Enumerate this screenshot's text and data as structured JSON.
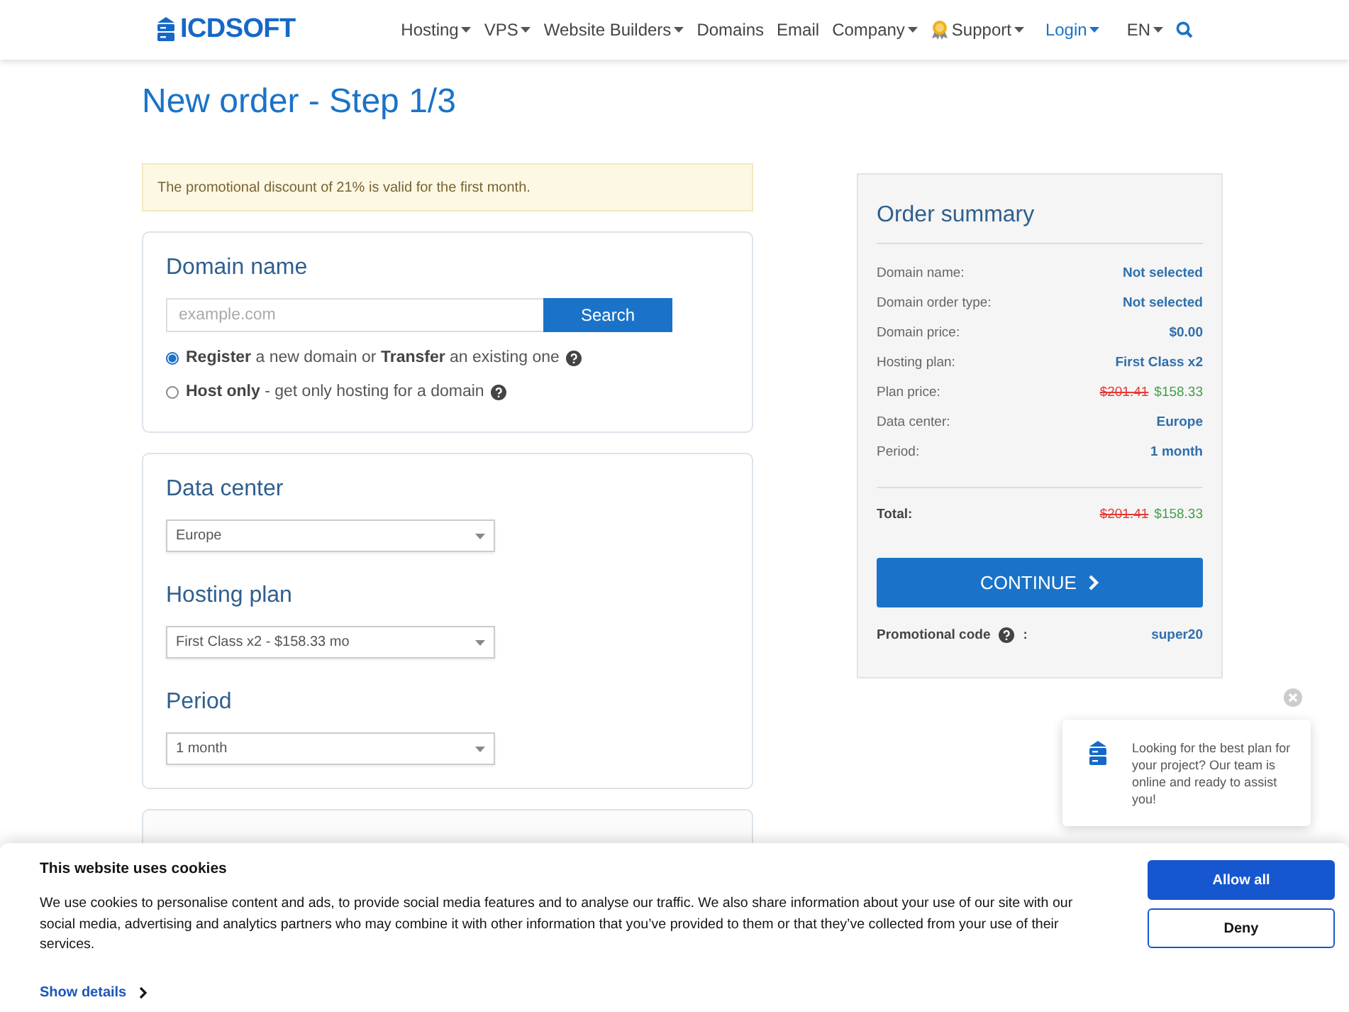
{
  "header": {
    "logo": "ICDSOFT",
    "nav": [
      {
        "label": "Hosting",
        "kind": "link",
        "dropdown": true,
        "highlighted": false
      },
      {
        "label": "VPS",
        "kind": "link",
        "dropdown": true,
        "highlighted": false
      },
      {
        "label": "Website Builders",
        "kind": "link",
        "dropdown": true,
        "highlighted": false
      },
      {
        "label": "Domains",
        "kind": "link",
        "dropdown": false,
        "highlighted": false
      },
      {
        "label": "Email",
        "kind": "link",
        "dropdown": false,
        "highlighted": false
      },
      {
        "label": "Company",
        "kind": "link",
        "dropdown": true,
        "highlighted": false
      },
      {
        "label": "Support",
        "kind": "support",
        "dropdown": true,
        "highlighted": false
      },
      {
        "label": "Login",
        "kind": "link",
        "dropdown": true,
        "highlighted": true
      },
      {
        "label": "EN",
        "kind": "link",
        "dropdown": true,
        "highlighted": false
      }
    ]
  },
  "page_title": "New order - Step 1/3",
  "notice": "The promotional discount of 21% is valid for the first month.",
  "domain": {
    "heading": "Domain name",
    "placeholder": "example.com",
    "button": "Search",
    "options": [
      {
        "label": "**Register** a new domain or **Transfer** an existing one",
        "selected": true
      },
      {
        "label": "**Host only** - get only hosting for a domain",
        "selected": false
      }
    ]
  },
  "selects": [
    {
      "heading": "Data center",
      "value": "Europe"
    },
    {
      "heading": "Hosting plan",
      "value": "First Class x2 - $158.33 mo"
    },
    {
      "heading": "Period",
      "value": "1 month"
    }
  ],
  "summary": {
    "title": "Order summary",
    "rows": [
      {
        "label": "Domain name:",
        "kind": "text",
        "value": "Not selected"
      },
      {
        "label": "Domain order type:",
        "kind": "text",
        "value": "Not selected"
      },
      {
        "label": "Domain price:",
        "kind": "text",
        "value": "$0.00"
      },
      {
        "label": "Hosting plan:",
        "kind": "text",
        "value": "First Class x2"
      },
      {
        "label": "Plan price:",
        "kind": "price",
        "old_value": "$201.41",
        "value": "$158.33"
      },
      {
        "label": "Data center:",
        "kind": "text",
        "value": "Europe"
      },
      {
        "label": "Period:",
        "kind": "text",
        "value": "1 month"
      }
    ],
    "total": {
      "label": "Total:",
      "old_value": "$201.41",
      "value": "$158.33"
    },
    "button": "CONTINUE",
    "promo_label": "Promotional code",
    "promo_separator": ":",
    "promo_value": "super20"
  },
  "chat": {
    "message": "Looking for the best plan for your project? Our team is online and ready to assist you!"
  },
  "cookies": {
    "title": "This website uses cookies",
    "text": "We use cookies to personalise content and ads, to provide social media features and to analyse our traffic. We also share information about your use of our site with our social media, advertising and analytics partners who may combine it with other information that you’ve provided to them or that they’ve collected from your use of their services.",
    "details_link": "Show details",
    "buttons": [
      {
        "label": "Allow all",
        "kind": "primary"
      },
      {
        "label": "Deny",
        "kind": "outline"
      }
    ]
  }
}
